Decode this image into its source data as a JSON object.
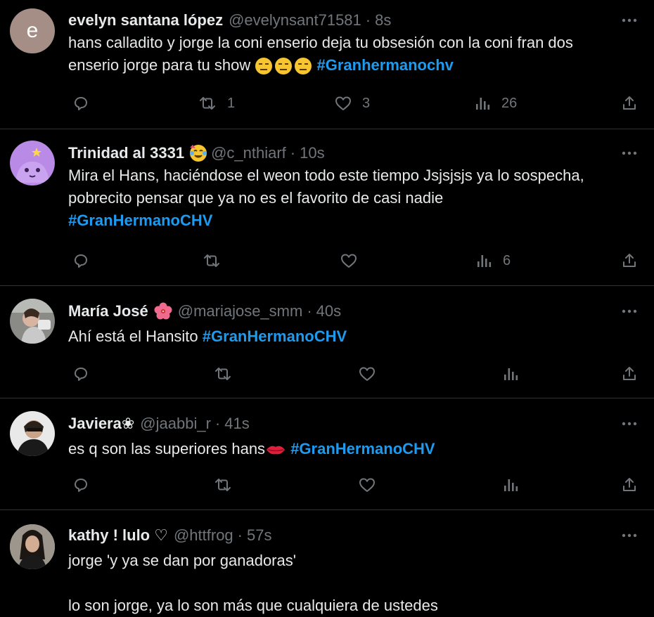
{
  "tweets": [
    {
      "name": "evelyn santana lópez",
      "handle": "@evelynsant71581",
      "time": "8s",
      "avatar_letter": "e",
      "text_lines": [
        "hans calladito y jorge la coni enserio deja tu obsesión con la coni fran dos",
        "enserio jorge para tu show "
      ],
      "hashtag": "#Granhermanochv",
      "replies": "",
      "retweets": "1",
      "likes": "3",
      "views": "26"
    },
    {
      "name": "Trinidad al 3331",
      "handle": "@c_nthiarf",
      "time": "10s",
      "text_lines": [
        "Mira el Hans, haciéndose el weon todo este tiempo Jsjsjsjs ya lo sospecha,",
        "pobrecito pensar que ya no es el favorito de casi nadie"
      ],
      "hashtag": "#GranHermanoCHV",
      "replies": "",
      "retweets": "",
      "likes": "",
      "views": "6"
    },
    {
      "name": "María José",
      "handle": "@mariajose_smm",
      "time": "40s",
      "text_prefix": "Ahí está el Hansito ",
      "hashtag": "#GranHermanoCHV",
      "replies": "",
      "retweets": "",
      "likes": "",
      "views": ""
    },
    {
      "name": "Javiera❀",
      "handle": "@jaabbi_r",
      "time": "41s",
      "text_prefix": "es q son las superiores hans",
      "hashtag": "#GranHermanoCHV",
      "replies": "",
      "retweets": "",
      "likes": "",
      "views": ""
    },
    {
      "name": "kathy ! lulo ♡",
      "handle": "@httfrog",
      "time": "57s",
      "text_lines": [
        "jorge 'y ya se dan por ganadoras'",
        "",
        "lo son jorge, ya lo son más que cualquiera de ustedes"
      ]
    }
  ],
  "colors": {
    "background": "#000000",
    "text": "#e7e9ea",
    "muted": "#71767b",
    "link": "#1d9bf0",
    "divider": "#2f3336"
  },
  "icons": [
    "more-icon",
    "reply-icon",
    "retweet-icon",
    "like-icon",
    "views-icon",
    "share-icon",
    "emoji-expressionless",
    "emoji-face-with-tears",
    "emoji-hibiscus",
    "emoji-lips"
  ]
}
